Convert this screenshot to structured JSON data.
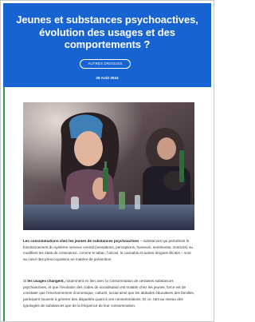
{
  "hero": {
    "title": "Jeunes et substances psychoactives, évolution des usages et des comportements ?",
    "category_label": "AUTRES DROGUES",
    "date": "28 Août 2024"
  },
  "article": {
    "para1_lead": "Les consommations chez les jeunes de substances psychoactives",
    "para1_rest": " – substances qui perturbent le fonctionnement du système nerveux central (sensations, perceptions, humeurs, sentiments, motricité) ou modifient les états de conscience, comme le tabac, l’alcool, le cannabis et autres drogues illicites – sont au cœur des préoccupations en matière de prévention.",
    "para2_start": "Si ",
    "para2_bold": "les usages changent,",
    "para2_rest": " notamment en lien avec la consommation de certaines substances psychoactives, et que l’évolution des codes de socialisation est notable chez les jeunes, force est de constater que l’environnement économique, culturel, social ainsi que les attitudes éducatives des familles, participent souvent à générer des disparités quant à ces consommations. Et ce, tant au niveau des typologies de substances que de la fréquence de leur consommation."
  },
  "colors": {
    "hero_background": "#1763d1",
    "accent_rule": "#2f9a4a",
    "body_text": "#333333"
  },
  "icons": {
    "photo": "party-scene-image"
  }
}
